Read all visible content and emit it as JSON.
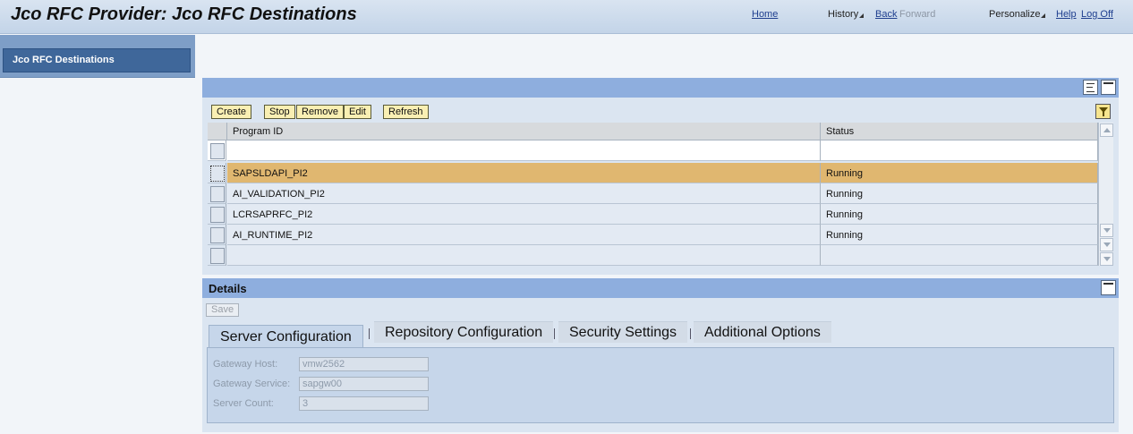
{
  "header": {
    "title": "Jco RFC Provider: Jco RFC Destinations",
    "home": "Home",
    "history": "History",
    "back": "Back",
    "forward": "Forward",
    "personalize": "Personalize",
    "help": "Help",
    "logoff": "Log Off"
  },
  "nav": {
    "items": [
      {
        "label": "Jco RFC Destinations",
        "selected": true
      }
    ]
  },
  "toolbar": {
    "create": "Create",
    "stop": "Stop",
    "remove": "Remove",
    "edit": "Edit",
    "refresh": "Refresh"
  },
  "table": {
    "columns": [
      "Program ID",
      "Status"
    ],
    "rows": [
      {
        "program_id": "SAPSLDAPI_PI2",
        "status": "Running",
        "selected": true
      },
      {
        "program_id": "AI_VALIDATION_PI2",
        "status": "Running",
        "selected": false
      },
      {
        "program_id": "LCRSAPRFC_PI2",
        "status": "Running",
        "selected": false
      },
      {
        "program_id": "AI_RUNTIME_PI2",
        "status": "Running",
        "selected": false
      }
    ]
  },
  "details": {
    "title": "Details",
    "save": "Save",
    "tabs": [
      "Server Configuration",
      "Repository Configuration",
      "Security Settings",
      "Additional Options"
    ],
    "active_tab": "Server Configuration",
    "fields": [
      {
        "label": "Gateway Host:",
        "value": "vmw2562"
      },
      {
        "label": "Gateway Service:",
        "value": "sapgw00"
      },
      {
        "label": "Server Count:",
        "value": "3"
      }
    ]
  },
  "colors": {
    "panel_bar": "#8eaede",
    "selected_row": "#e0b770",
    "button_bg": "#f9efb3"
  }
}
